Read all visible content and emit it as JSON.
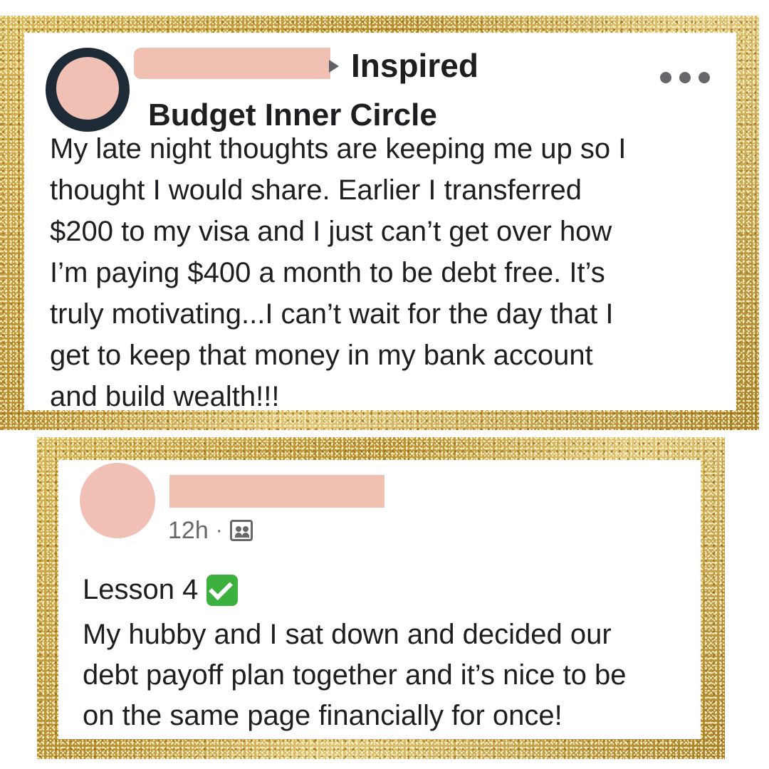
{
  "post": {
    "mood": "Inspired",
    "group": "Budget Inner Circle",
    "text": "My late night thoughts are keeping me up so I\nthought I would share. Earlier I transferred\n$200 to my visa and I just can’t get over how\nI’m paying $400 a month to be debt free. It’s\ntruly motivating...I can’t wait for the day that I\nget to keep that money in my bank account\nand build wealth!!!",
    "icons": {
      "more": "more-options-icon",
      "arrow": "arrow-right-icon"
    }
  },
  "comment": {
    "time": "12h",
    "separator": "·",
    "lesson": "Lesson 4",
    "text": "My hubby and I sat down and decided our\ndebt payoff plan together and it’s nice to be\non the same page financially for once!",
    "icons": {
      "audience": "group-audience-icon",
      "check": "check-mark-icon"
    }
  },
  "colors": {
    "frame": "#c9a23d",
    "redaction": "#f0c0b3",
    "check": "#3db13d"
  }
}
